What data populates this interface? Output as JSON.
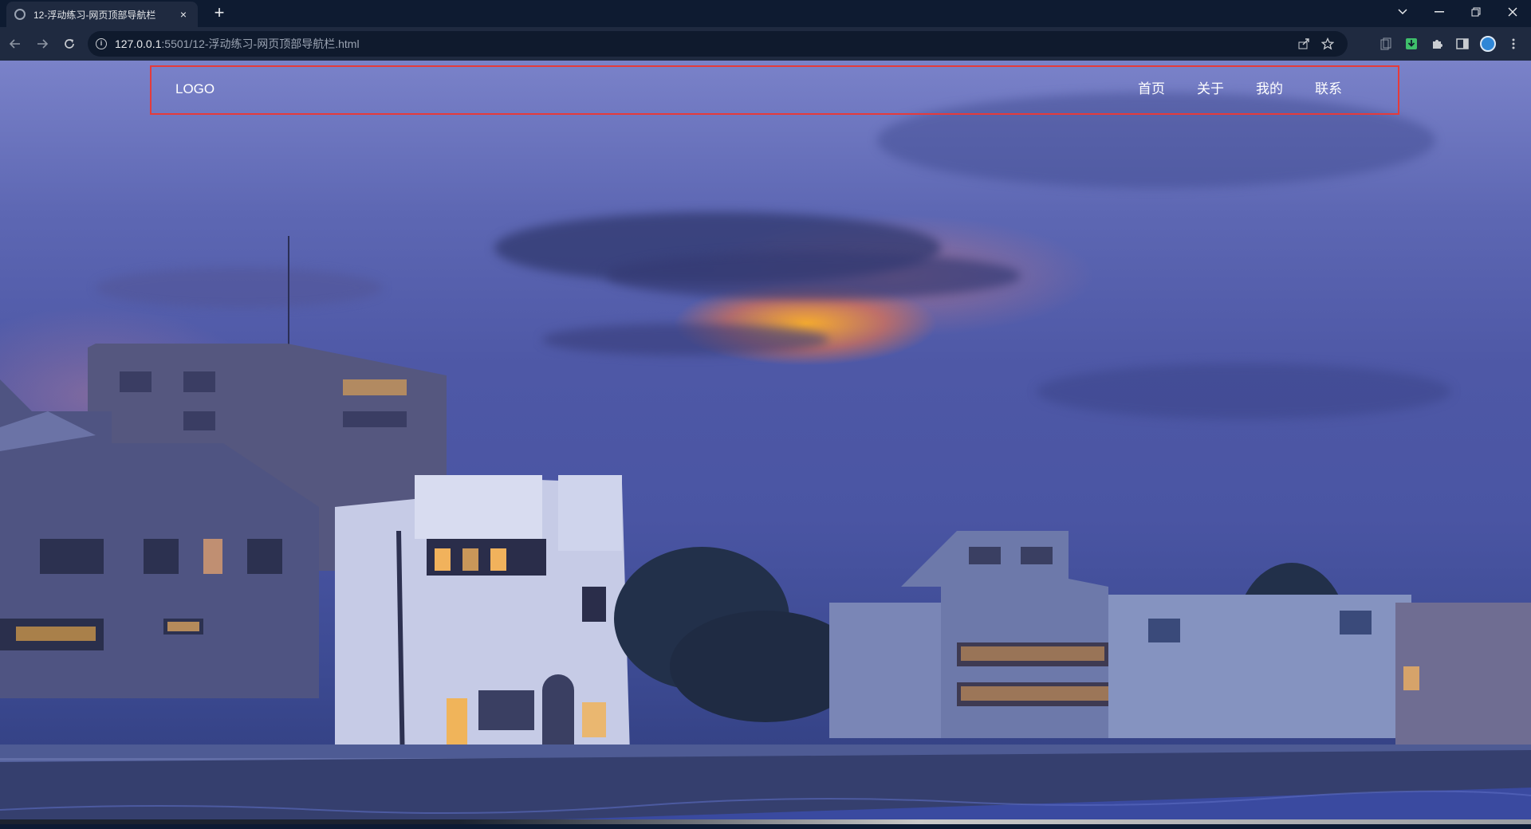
{
  "browser": {
    "tab_title": "12-浮动练习-网页顶部导航栏",
    "tab_close": "×",
    "new_tab": "+",
    "url_host": "127.0.0.1",
    "url_path": ":5501/12-浮动练习-网页顶部导航栏.html",
    "icons": {
      "back": "back-arrow-icon",
      "forward": "forward-arrow-icon",
      "reload": "reload-icon",
      "info": "info-icon",
      "share": "share-icon",
      "bookmark": "star-icon",
      "extensions": "puzzle-icon",
      "sidepanel": "side-panel-icon",
      "menu": "kebab-menu-icon"
    }
  },
  "page": {
    "logo": "LOGO",
    "nav": [
      {
        "label": "首页"
      },
      {
        "label": "关于"
      },
      {
        "label": "我的"
      },
      {
        "label": "联系"
      }
    ],
    "colors": {
      "header_border": "#e53b3b",
      "nav_text": "#ffffff"
    }
  }
}
